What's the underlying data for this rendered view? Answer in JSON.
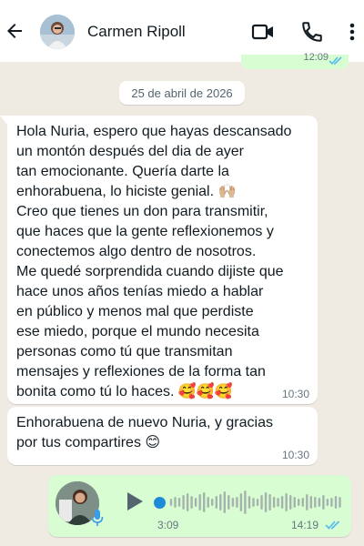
{
  "header": {
    "contact_name": "Carmen Ripoll",
    "icons": [
      "back-arrow-icon",
      "avatar",
      "video-call-icon",
      "phone-icon",
      "more-options-icon"
    ]
  },
  "previous_message": {
    "time": "12:09"
  },
  "date_chip": "25 de abril de 2026",
  "messages": [
    {
      "direction": "incoming",
      "text": "Hola Nuria, espero que hayas descansado\nun montón después del dia de ayer\ntan emocionante. Quería darte la\nenhorabuena, lo hiciste genial. 🙌🏼\nCreo que tienes un don para transmitir,\nque haces que la gente reflexionemos y\nconectemos algo dentro de nosotros.\nMe quedé sorprendida cuando dijiste que\nhace unos años tenías miedo a hablar\nen público y menos mal que perdiste\nese miedo, porque el mundo necesita\npersonas como tú que transmitan\nmensajes y reflexiones de la forma tan\nbonita como tú lo haces. 🥰🥰🥰",
      "time": "10:30"
    },
    {
      "direction": "incoming",
      "text": "Enhorabuena de nuevo Nuria, y gracias\npor tus compartires 😊",
      "time": "10:30"
    }
  ],
  "voice_message": {
    "direction": "outgoing",
    "duration": "3:09",
    "time": "14:19",
    "played_fraction": 0,
    "status": "read"
  },
  "colors": {
    "chat_background": "#efeae2",
    "incoming_bubble": "#ffffff",
    "outgoing_bubble": "#d9fdd3",
    "read_ticks": "#53bdeb",
    "seek_dot": "#1e8bd8"
  }
}
